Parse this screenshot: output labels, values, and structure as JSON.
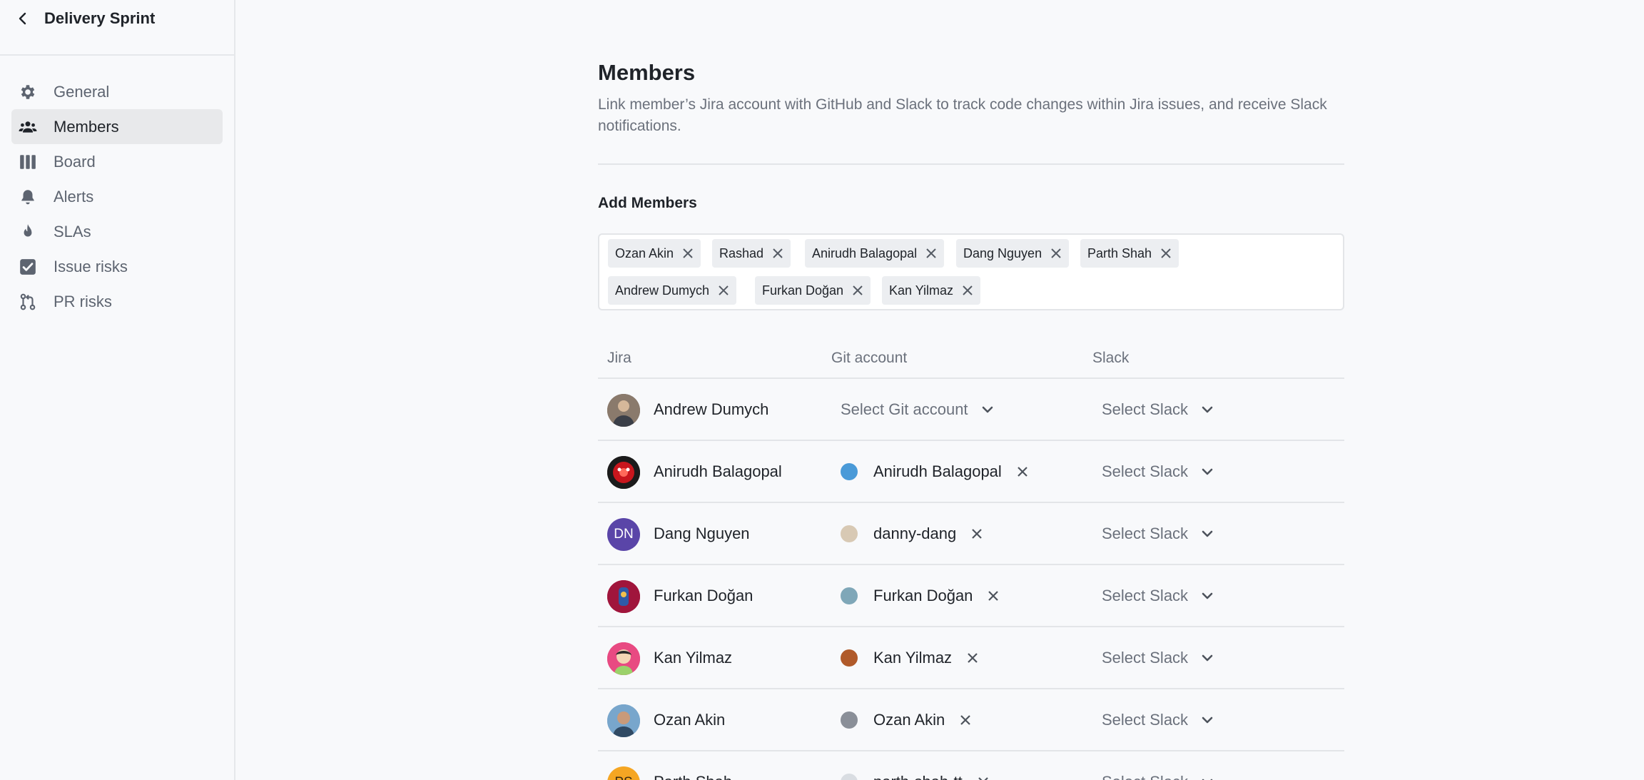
{
  "sidebar": {
    "title": "Delivery Sprint",
    "items": [
      {
        "label": "General",
        "icon": "gear-icon"
      },
      {
        "label": "Members",
        "icon": "users-icon"
      },
      {
        "label": "Board",
        "icon": "board-icon"
      },
      {
        "label": "Alerts",
        "icon": "bell-icon"
      },
      {
        "label": "SLAs",
        "icon": "flame-icon"
      },
      {
        "label": "Issue risks",
        "icon": "checkbox-icon"
      },
      {
        "label": "PR risks",
        "icon": "git-pull-request-icon"
      }
    ],
    "active": "Members"
  },
  "main": {
    "title": "Members",
    "description": "Link member’s Jira account with GitHub and Slack to track code changes within Jira issues, and receive Slack notifications.",
    "add_members_title": "Add Members",
    "chips": [
      "Ozan Akin",
      "Rashad",
      "Anirudh Balagopal",
      "Dang Nguyen",
      "Parth Shah",
      "Andrew Dumych",
      "Furkan Doğan",
      "Kan Yilmaz"
    ]
  },
  "table": {
    "headers": {
      "jira": "Jira",
      "git": "Git account",
      "slack": "Slack"
    },
    "rows": [
      {
        "name": "Andrew Dumych",
        "git": "",
        "git_placeholder": "Select Git account",
        "slack": "Select Slack"
      },
      {
        "name": "Anirudh Balagopal",
        "git": "Anirudh Balagopal",
        "slack": "Select Slack"
      },
      {
        "name": "Dang Nguyen",
        "initials": "DN",
        "git": "danny-dang",
        "slack": "Select Slack"
      },
      {
        "name": "Furkan Doğan",
        "git": "Furkan Doğan",
        "slack": "Select Slack"
      },
      {
        "name": "Kan Yilmaz",
        "git": "Kan Yilmaz",
        "slack": "Select Slack"
      },
      {
        "name": "Ozan Akin",
        "git": "Ozan Akin",
        "slack": "Select Slack"
      },
      {
        "name": "Parth Shah",
        "initials": "PS",
        "git": "parth-shah-tt",
        "slack": "Select Slack"
      }
    ]
  },
  "colors": {
    "accent_dn": "#5a45a8",
    "accent_ps": "#f5a623",
    "background": "#f8f9fb"
  }
}
